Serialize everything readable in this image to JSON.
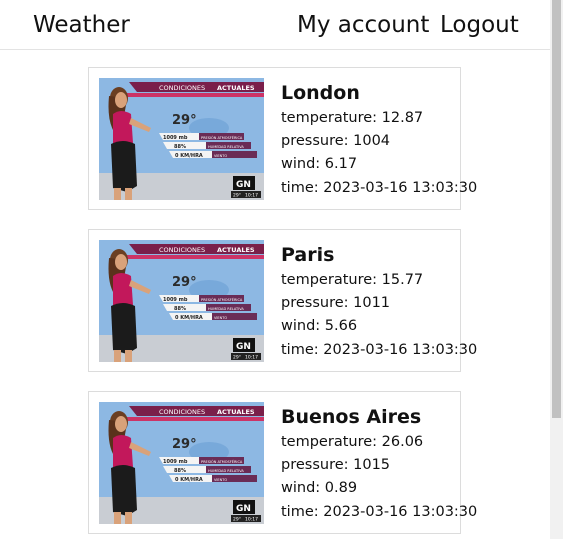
{
  "navbar": {
    "brand": "Weather",
    "account_label": "My account",
    "logout_label": "Logout"
  },
  "thumbnail": {
    "banner_text_1": "CONDICIONES",
    "banner_text_2": "ACTUALES",
    "temperature": "29°",
    "rows": [
      "1009 mb",
      "88%",
      "0 KM/HRA"
    ],
    "row_labels": [
      "PRESIÓN ATMOSFÉRICA",
      "HUMEDAD RELATIVA",
      "VIENTO"
    ],
    "footer_temp": "29°",
    "footer_time": "10:17",
    "logo_text": "GN"
  },
  "cities": [
    {
      "name": "London",
      "temperature_label": "temperature: 12.87",
      "pressure_label": "pressure: 1004",
      "wind_label": "wind: 6.17",
      "time_label": "time: 2023-03-16 13:03:30"
    },
    {
      "name": "Paris",
      "temperature_label": "temperature: 15.77",
      "pressure_label": "pressure: 1011",
      "wind_label": "wind: 5.66",
      "time_label": "time: 2023-03-16 13:03:30"
    },
    {
      "name": "Buenos Aires",
      "temperature_label": "temperature: 26.06",
      "pressure_label": "pressure: 1015",
      "wind_label": "wind: 0.89",
      "time_label": "time: 2023-03-16 13:03:30"
    }
  ]
}
